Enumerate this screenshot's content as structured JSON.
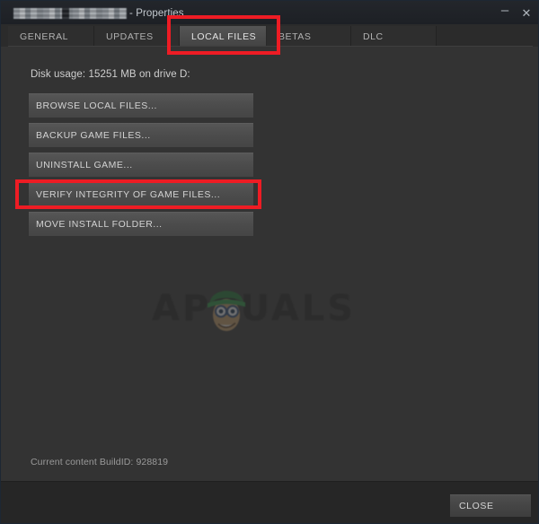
{
  "window": {
    "title_redacted": true,
    "title_suffix": "- Properties",
    "minimize_icon": "minimize-icon",
    "close_icon": "close-icon",
    "minimize_glyph": "–",
    "close_glyph": "✕"
  },
  "tabs": [
    {
      "label": "GENERAL",
      "active": false
    },
    {
      "label": "UPDATES",
      "active": false
    },
    {
      "label": "LOCAL FILES",
      "active": true
    },
    {
      "label": "BETAS",
      "active": false
    },
    {
      "label": "DLC",
      "active": false
    }
  ],
  "content": {
    "disk_usage": "Disk usage: 15251 MB on drive D:",
    "buttons": [
      {
        "label": "BROWSE LOCAL FILES..."
      },
      {
        "label": "BACKUP GAME FILES..."
      },
      {
        "label": "UNINSTALL GAME..."
      },
      {
        "label": "VERIFY INTEGRITY OF GAME FILES..."
      },
      {
        "label": "MOVE INSTALL FOLDER..."
      }
    ],
    "build_id": "Current content BuildID: 928819"
  },
  "watermark": {
    "text": "APPUALS"
  },
  "footer": {
    "close_label": "CLOSE"
  },
  "annotations": {
    "color": "#ee1c24",
    "boxes": [
      {
        "target": "local-files-tab"
      },
      {
        "target": "verify-integrity-button"
      }
    ]
  }
}
